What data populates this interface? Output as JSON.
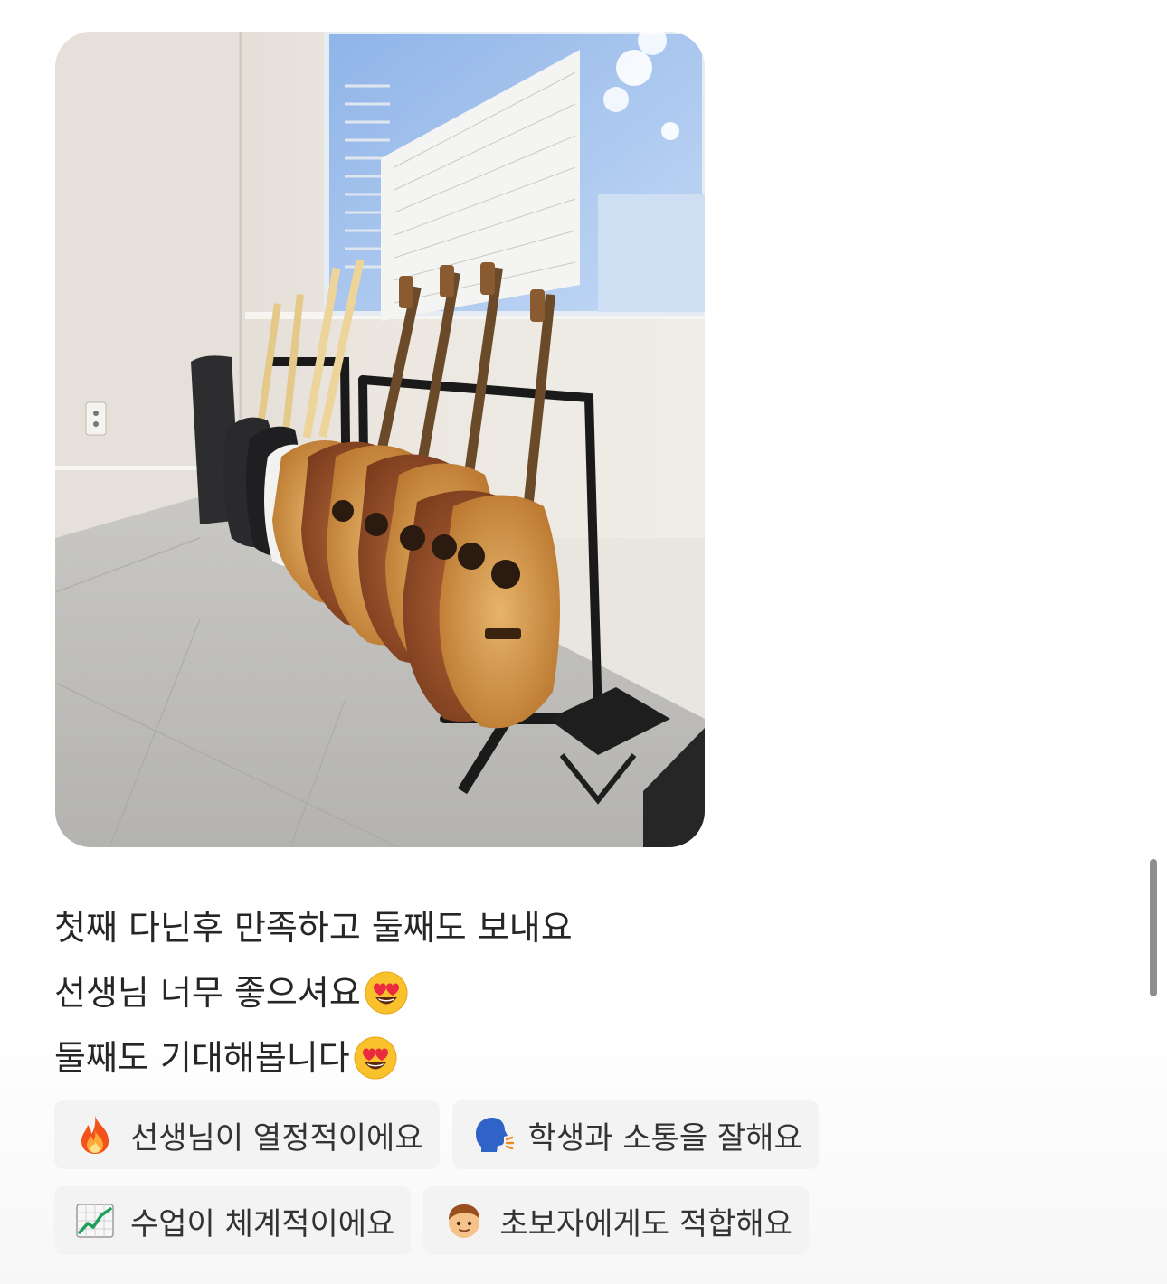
{
  "review": {
    "lines": [
      "첫째 다닌후 만족하고 둘째도 보내요",
      "선생님 너무 좋으셔요",
      "둘째도 기대해봅니다"
    ],
    "line_emojis": [
      "",
      "heart-eyes-emoji",
      "heart-eyes-emoji"
    ]
  },
  "photo": {
    "icon": "guitar-stand-photo"
  },
  "chips": [
    {
      "icon": "fire-icon",
      "label": "선생님이 열정적이에요"
    },
    {
      "icon": "speaking-head-icon",
      "label": "학생과 소통을 잘해요"
    },
    {
      "icon": "chart-increasing-icon",
      "label": "수업이 체계적이에요"
    },
    {
      "icon": "boy-icon",
      "label": "초보자에게도 적합해요"
    }
  ],
  "colors": {
    "chip_bg": "#f3f3f3",
    "text": "#262626",
    "scrollbar": "#8e8e8e"
  }
}
